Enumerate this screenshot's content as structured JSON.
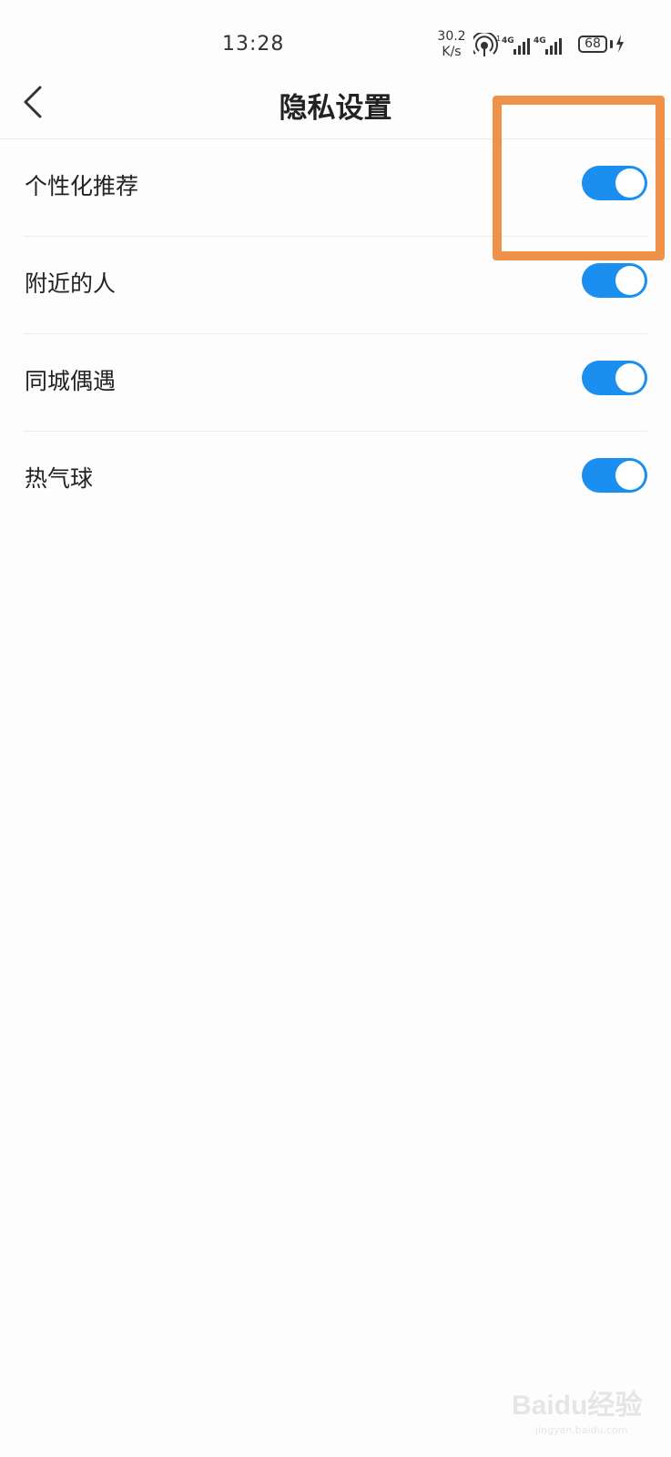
{
  "status_bar": {
    "time": "13:28",
    "net_speed_value": "30.2",
    "net_speed_unit": "K/s",
    "battery_level": "68",
    "icons": [
      "hotspot-icon",
      "signal-4g-icon",
      "signal-4g-icon",
      "battery-icon",
      "charging-icon"
    ]
  },
  "header": {
    "title": "隐私设置",
    "back_icon": "chevron-left-icon"
  },
  "settings": {
    "items": [
      {
        "label": "个性化推荐",
        "enabled": true
      },
      {
        "label": "附近的人",
        "enabled": true
      },
      {
        "label": "同城偶遇",
        "enabled": true
      },
      {
        "label": "热气球",
        "enabled": true
      }
    ]
  },
  "colors": {
    "toggle_on": "#1a8ff0",
    "highlight": "#f0914a",
    "background": "#fdfdfd"
  },
  "watermark": {
    "logo": "Baidu经验",
    "url": "jingyan.baidu.com"
  }
}
